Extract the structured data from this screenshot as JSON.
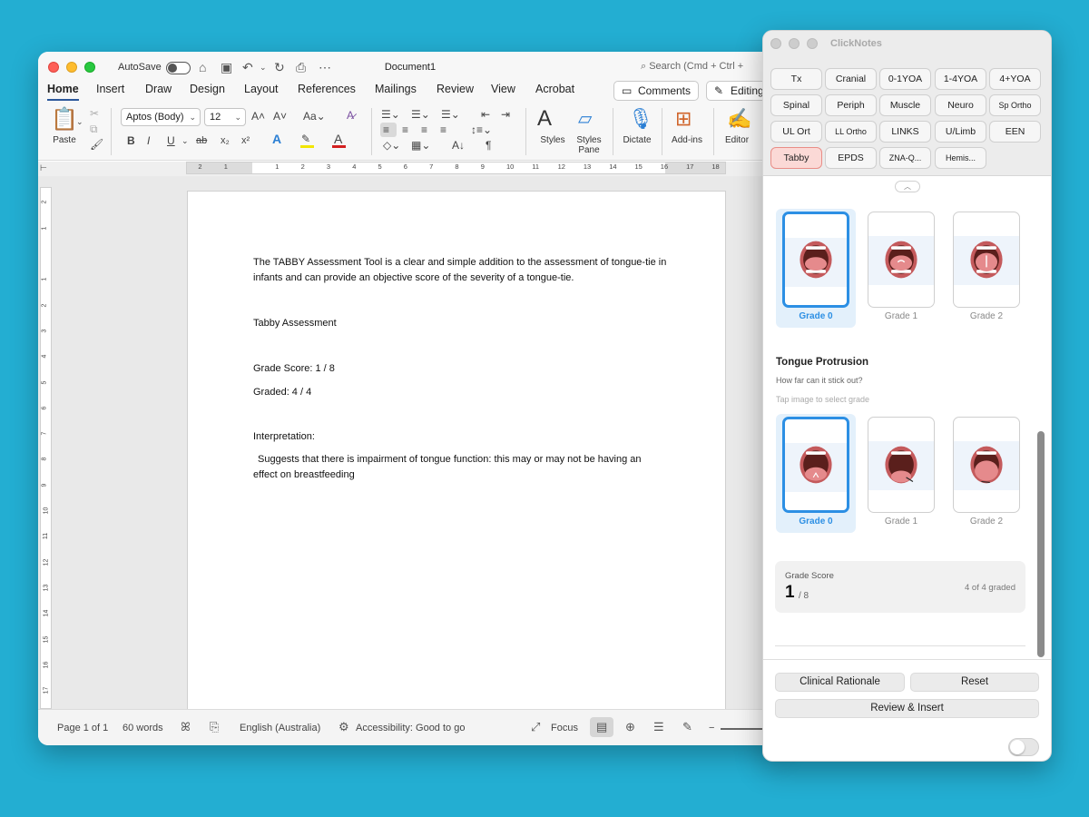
{
  "word": {
    "autosave_label": "AutoSave",
    "doc_title": "Document1",
    "search_placeholder": "Search (Cmd + Ctrl +",
    "tabs": [
      "Home",
      "Insert",
      "Draw",
      "Design",
      "Layout",
      "References",
      "Mailings",
      "Review",
      "View",
      "Acrobat"
    ],
    "comments_label": "Comments",
    "editing_label": "Editing",
    "ribbon": {
      "paste_label": "Paste",
      "font_name": "Aptos (Body)",
      "font_size": "12",
      "styles_label": "Styles",
      "styles_pane_label": "Styles Pane",
      "dictate_label": "Dictate",
      "addins_label": "Add-ins",
      "editor_label": "Editor"
    },
    "ruler_numbers": [
      "2",
      "1",
      "1",
      "2",
      "3",
      "4",
      "5",
      "6",
      "7",
      "8",
      "9",
      "10",
      "11",
      "12",
      "13",
      "14",
      "15",
      "16",
      "17",
      "18"
    ],
    "vruler_numbers": [
      "2",
      "1",
      "1",
      "2",
      "3",
      "4",
      "5",
      "6",
      "7",
      "8",
      "9",
      "10",
      "11",
      "12",
      "13",
      "14",
      "15",
      "16",
      "17",
      "18"
    ],
    "document": {
      "intro": "The TABBY Assessment Tool is a clear and simple addition to the assessment of tongue-tie in infants and can provide an objective score of the severity of a tongue-tie.",
      "heading": "Tabby Assessment",
      "grade_score": "Grade Score: 1 / 8",
      "graded": "Graded: 4 / 4",
      "interpretation_label": "Interpretation:",
      "interpretation_text": "Suggests that there is impairment of tongue function: this may or may not be having an effect on breastfeeding"
    },
    "status": {
      "page": "Page 1 of 1",
      "words": "60 words",
      "language": "English (Australia)",
      "accessibility": "Accessibility: Good to go",
      "focus": "Focus"
    }
  },
  "clicknotes": {
    "title": "ClickNotes",
    "chips": [
      "Tx",
      "Cranial",
      "0-1YOA",
      "1-4YOA",
      "4+YOA",
      "Spinal",
      "Periph",
      "Muscle",
      "Neuro",
      "Sp Ortho",
      "UL Ort",
      "LL Ortho",
      "LINKS",
      "U/Limb",
      "EEN",
      "Tabby",
      "EPDS",
      "ZNA-Q...",
      "Hemis..."
    ],
    "active_chip": "Tabby",
    "grades_top": [
      "Grade 0",
      "Grade 1",
      "Grade 2"
    ],
    "section_title": "Tongue Protrusion",
    "section_subtitle": "How far can it stick out?",
    "section_hint": "Tap image to select grade",
    "grades_bottom": [
      "Grade 0",
      "Grade 1",
      "Grade 2"
    ],
    "score": {
      "label": "Grade Score",
      "value": "1",
      "denominator": "/ 8",
      "graded": "4 of 4 graded"
    },
    "buttons": {
      "clinical_rationale": "Clinical Rationale",
      "reset": "Reset",
      "review_insert": "Review & Insert"
    }
  },
  "colors": {
    "desktop": "#23aed2",
    "word_accent": "#2b579a",
    "selected_grade": "#2c8fe4",
    "active_chip": "#fbd9d6"
  }
}
